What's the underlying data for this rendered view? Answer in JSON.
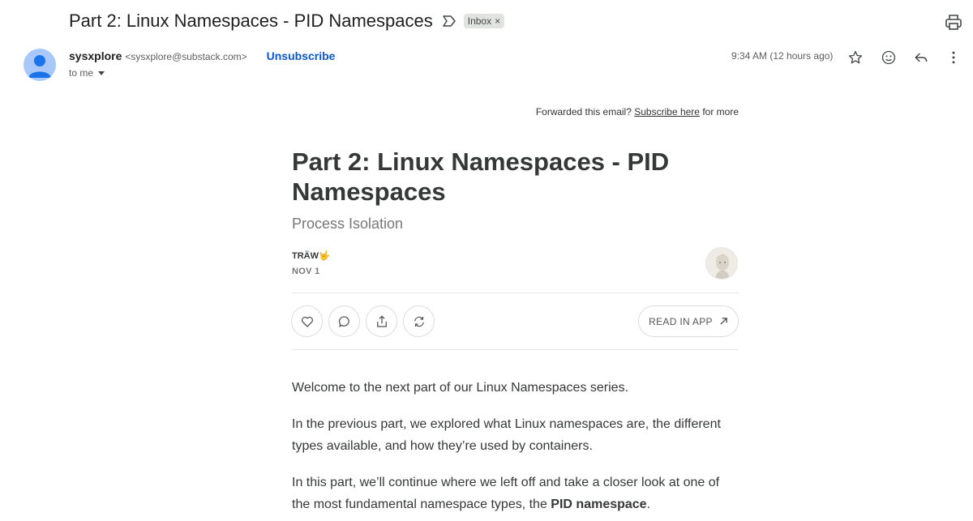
{
  "email": {
    "subject": "Part 2: Linux Namespaces - PID Namespaces",
    "label_chip": "Inbox",
    "label_chip_close": "×",
    "sender_name": "sysxplore",
    "sender_email": "<sysxplore@substack.com>",
    "unsubscribe": "Unsubscribe",
    "recipient": "to me",
    "timestamp": "9:34 AM (12 hours ago)"
  },
  "newsletter": {
    "forward_prefix": "Forwarded this email?",
    "forward_link": "Subscribe here",
    "forward_suffix": "for more",
    "title": "Part 2: Linux Namespaces - PID Namespaces",
    "subtitle": "Process Isolation",
    "author": "TRÄW🤟",
    "date": "NOV 1",
    "read_in_app": "READ IN APP",
    "paragraphs": {
      "p1": "Welcome to the next part of our Linux Namespaces series.",
      "p2": "In the previous part, we explored what Linux namespaces are, the different types available, and how they’re used by containers.",
      "p3_start": "In this part, we’ll continue where we left off and take a closer look at one of the most fundamental namespace types, the ",
      "p3_bold": "PID namespace",
      "p3_end": "."
    }
  },
  "icons": {
    "label": "label-outline-icon",
    "print": "printer-icon",
    "star": "star-icon",
    "emoji": "smiley-icon",
    "reply": "reply-icon",
    "more": "more-vert-icon",
    "like": "heart-icon",
    "comment": "comment-bubble-icon",
    "share": "share-icon",
    "restack": "restack-icon",
    "open": "arrow-up-right-icon"
  },
  "colors": {
    "link_blue": "#0b57d0",
    "avatar_bg": "#a8c7fa",
    "avatar_fg": "#1a73e8"
  }
}
